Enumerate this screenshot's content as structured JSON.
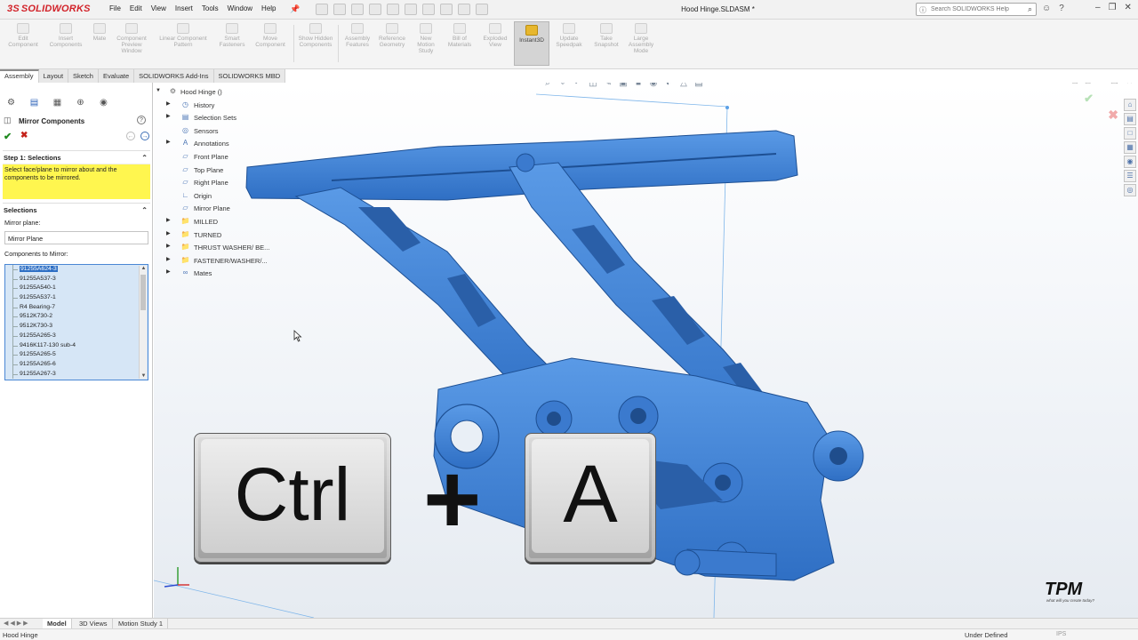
{
  "app": {
    "logo_text": "SOLIDWORKS",
    "document_title": "Hood Hinge.SLDASM *",
    "menu": [
      "File",
      "Edit",
      "View",
      "Insert",
      "Tools",
      "Window",
      "Help"
    ],
    "search_placeholder": "Search SOLIDWORKS Help",
    "brand_color": "#d2232a"
  },
  "commands": [
    {
      "label": "Edit Component"
    },
    {
      "label": "Insert Components"
    },
    {
      "label": "Mate"
    },
    {
      "label": "Component Preview Window"
    },
    {
      "label": "Linear Component Pattern"
    },
    {
      "label": "Smart Fasteners"
    },
    {
      "label": "Move Component"
    },
    {
      "label": "Show Hidden Components"
    },
    {
      "label": "Assembly Features"
    },
    {
      "label": "Reference Geometry"
    },
    {
      "label": "New Motion Study"
    },
    {
      "label": "Bill of Materials"
    },
    {
      "label": "Exploded View"
    },
    {
      "label": "Instant3D"
    },
    {
      "label": "Update Speedpak"
    },
    {
      "label": "Take Snapshot"
    },
    {
      "label": "Large Assembly Mode"
    }
  ],
  "tabs": [
    "Assembly",
    "Layout",
    "Sketch",
    "Evaluate",
    "SOLIDWORKS Add-Ins",
    "SOLIDWORKS MBD"
  ],
  "property_manager": {
    "title": "Mirror Components",
    "help": "?",
    "step_title": "Step 1: Selections",
    "step_message": "Select face/plane to mirror about and the components to be mirrored.",
    "selections_title": "Selections",
    "mirror_plane_label": "Mirror plane:",
    "mirror_plane_value": "Mirror Plane",
    "components_label": "Components to Mirror:",
    "components": [
      "91255A624-3",
      "91255A537-3",
      "91255A540-1",
      "91255A537-1",
      "R4 Bearing-7",
      "9512K730-2",
      "9512K730-3",
      "91255A265-3",
      "9416K117-130 sub-4",
      "91255A265-5",
      "91255A265-6",
      "91255A267-3"
    ]
  },
  "tree": {
    "root": "Hood Hinge",
    "root_suffix": "()",
    "items": [
      {
        "label": "History",
        "icon": "history-icon"
      },
      {
        "label": "Selection Sets",
        "icon": "selection-sets-icon"
      },
      {
        "label": "Sensors",
        "icon": "sensors-icon"
      },
      {
        "label": "Annotations",
        "icon": "annotations-icon"
      },
      {
        "label": "Front Plane",
        "icon": "plane-icon"
      },
      {
        "label": "Top Plane",
        "icon": "plane-icon"
      },
      {
        "label": "Right Plane",
        "icon": "plane-icon"
      },
      {
        "label": "Origin",
        "icon": "origin-icon"
      },
      {
        "label": "Mirror Plane",
        "icon": "plane-icon"
      },
      {
        "label": "MILLED",
        "icon": "folder-icon"
      },
      {
        "label": "TURNED",
        "icon": "folder-icon"
      },
      {
        "label": "THRUST WASHER/ BE...",
        "icon": "folder-icon"
      },
      {
        "label": "FASTENER/WASHER/...",
        "icon": "folder-icon"
      },
      {
        "label": "Mates",
        "icon": "mates-icon"
      }
    ]
  },
  "overlay": {
    "key1": "Ctrl",
    "plus": "+",
    "key2": "A"
  },
  "model_color": "#3f84d8",
  "bottom_tabs": [
    "Model",
    "3D Views",
    "Motion Study 1"
  ],
  "status": {
    "left": "Hood Hinge",
    "state": "Under Defined",
    "units": "IPS"
  },
  "watermark": {
    "brand": "TPM",
    "tagline": "what will you create today?"
  }
}
